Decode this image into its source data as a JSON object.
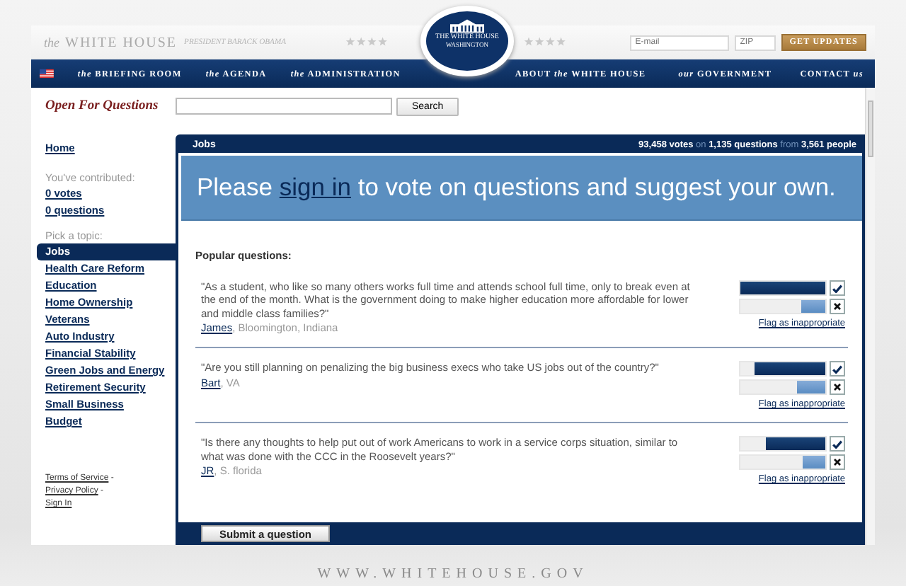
{
  "header": {
    "logo_prefix": "the",
    "logo": "WHITE HOUSE",
    "tagline": "PRESIDENT BARACK OBAMA",
    "seal_title": "THE WHITE HOUSE",
    "seal_subtitle": "WASHINGTON",
    "email": {
      "placeholder": "E-mail"
    },
    "zip": {
      "placeholder": "ZIP"
    },
    "updates_button": "GET UPDATES"
  },
  "nav": [
    {
      "label": "*the* BRIEFING ROOM"
    },
    {
      "label": "*the* AGENDA"
    },
    {
      "label": "*the* ADMINISTRATION"
    },
    {
      "label": "ABOUT *the* WHITE HOUSE"
    },
    {
      "label": "*our* GOVERNMENT"
    },
    {
      "label": "CONTACT *us*"
    }
  ],
  "page_title": "Open For Questions",
  "search": {
    "button": "Search"
  },
  "sidebar": {
    "home": "Home",
    "contributed_label": "You've contributed:",
    "votes": "0 votes",
    "questions": "0 questions",
    "topic_label": "Pick a topic:",
    "topics": [
      {
        "label": "Jobs",
        "selected": true
      },
      {
        "label": "Health Care Reform",
        "selected": false
      },
      {
        "label": "Education",
        "selected": false
      },
      {
        "label": "Home Ownership",
        "selected": false
      },
      {
        "label": "Veterans",
        "selected": false
      },
      {
        "label": "Auto Industry",
        "selected": false
      },
      {
        "label": "Financial Stability",
        "selected": false
      },
      {
        "label": "Green Jobs and Energy",
        "selected": false
      },
      {
        "label": "Retirement Security",
        "selected": false
      },
      {
        "label": "Small Business",
        "selected": false
      },
      {
        "label": "Budget",
        "selected": false
      }
    ],
    "footer_links": [
      {
        "label": "Terms of Service",
        "separator": "-"
      },
      {
        "label": "Privacy Policy",
        "separator": "-"
      },
      {
        "label": "Sign In"
      }
    ]
  },
  "panel": {
    "title": "Jobs",
    "stats": "**93,458 votes** on **1,135 questions** from **3,561 people**",
    "banner": {
      "before": "Please",
      "link": "sign in",
      "after": "to vote on questions and suggest your own."
    },
    "popular_label": "Popular questions:",
    "questions": [
      {
        "text": "\"As a student, who like so many others works full time and attends school full time, only to break even at the end of the month. What is the government doing to make higher education more affordable for lower and middle class families?\"",
        "author": "James",
        "location": ", Bloomington, Indiana",
        "yes": {
          "level": 1.0
        },
        "no": {
          "level": 0.28
        },
        "flag": "Flag as inappropriate"
      },
      {
        "text": "\"Are you still planning on penalizing the big business execs who take US jobs out of the country?\"",
        "author": "Bart",
        "location": ", VA",
        "yes": {
          "level": 0.83
        },
        "no": {
          "level": 0.33
        },
        "flag": "Flag as inappropriate"
      },
      {
        "text": "\"Is there any thoughts to help put out of work Americans to work in a service corps situation, similar to what was done with the CCC in the Roosevelt years?\"",
        "author": "JR",
        "location": ", S. florida",
        "yes": {
          "level": 0.7
        },
        "no": {
          "level": 0.27
        },
        "flag": "Flag as inappropriate"
      }
    ],
    "submit_button": "Submit a question"
  },
  "footer": "WWW.WHITEHOUSE.GOV"
}
